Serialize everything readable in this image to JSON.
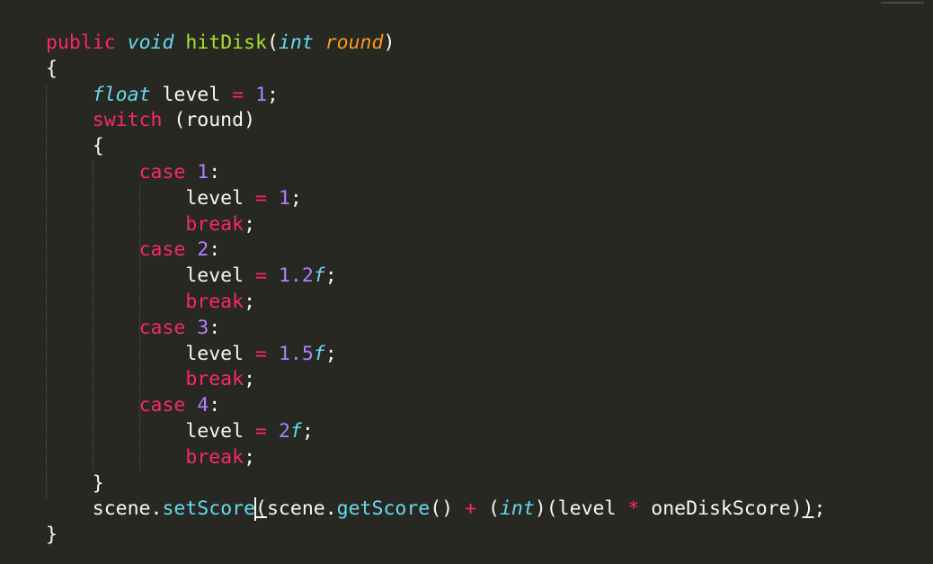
{
  "code": {
    "line1": {
      "modifier": "public",
      "return_type": "void",
      "function_name": "hitDisk",
      "open_paren": "(",
      "param_type": "int",
      "param_name": "round",
      "close_paren": ")"
    },
    "line2": {
      "brace": "{"
    },
    "line3": {
      "type": "float",
      "var": "level",
      "assign": "=",
      "value": "1",
      "end": ";"
    },
    "line4": {
      "keyword": "switch",
      "expr": "(round)"
    },
    "line5": {
      "brace": "{"
    },
    "cases": [
      {
        "keyword": "case",
        "label": "1",
        "colon": ":",
        "var": "level",
        "assign": "=",
        "value": "1",
        "value_suffix": "",
        "end": ";",
        "break_kw": "break",
        "break_end": ";"
      },
      {
        "keyword": "case",
        "label": "2",
        "colon": ":",
        "var": "level",
        "assign": "=",
        "value": "1.2",
        "value_suffix": "f",
        "end": ";",
        "break_kw": "break",
        "break_end": ";"
      },
      {
        "keyword": "case",
        "label": "3",
        "colon": ":",
        "var": "level",
        "assign": "=",
        "value": "1.5",
        "value_suffix": "f",
        "end": ";",
        "break_kw": "break",
        "break_end": ";"
      },
      {
        "keyword": "case",
        "label": "4",
        "colon": ":",
        "var": "level",
        "assign": "=",
        "value": "2",
        "value_suffix": "f",
        "end": ";",
        "break_kw": "break",
        "break_end": ";"
      }
    ],
    "line18": {
      "brace": "}"
    },
    "line19": {
      "obj": "scene",
      "dot": ".",
      "method1": "setScore",
      "paren_open": "(",
      "obj2": "scene",
      "dot2": ".",
      "method2": "getScore",
      "call_parens": "()",
      "plus": "+",
      "cast_open": "(",
      "cast_type": "int",
      "cast_close": ")",
      "inner_open": "(level",
      "mult": "*",
      "operand": "oneDiskScore",
      "inner_close": ")",
      "close_call": ")",
      "end": ";"
    },
    "line20": {
      "brace": "}"
    }
  }
}
